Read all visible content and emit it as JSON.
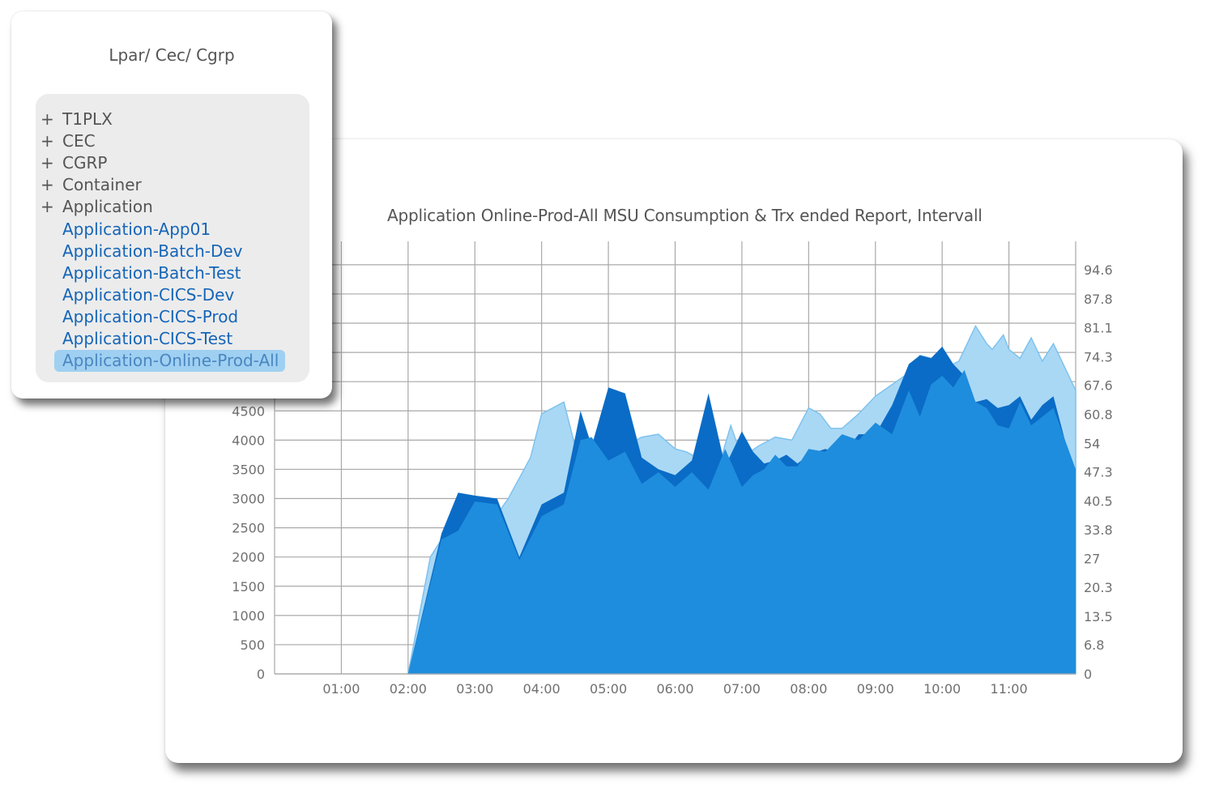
{
  "tree": {
    "header": "Lpar/ Cec/ Cgrp",
    "groups": [
      {
        "expander": "+",
        "label": "T1PLX"
      },
      {
        "expander": "+",
        "label": "CEC"
      },
      {
        "expander": "+",
        "label": "CGRP"
      },
      {
        "expander": "+",
        "label": "Container"
      },
      {
        "expander": "+",
        "label": "Application"
      }
    ],
    "leaves": [
      "Application-App01",
      "Application-Batch-Dev",
      "Application-Batch-Test",
      "Application-CICS-Dev",
      "Application-CICS-Prod",
      "Application-CICS-Test",
      "Application-Online-Prod-All"
    ],
    "selected_index": 6
  },
  "chart_data": {
    "type": "area",
    "title": "Application Online-Prod-All MSU Consumption & Trx ended Report, Intervall",
    "x_ticks": [
      "01:00",
      "02:00",
      "03:00",
      "04:00",
      "05:00",
      "06:00",
      "07:00",
      "08:00",
      "09:00",
      "10:00",
      "11:00"
    ],
    "x_range": [
      "00:00",
      "12:00"
    ],
    "y_left": {
      "ticks": [
        "0",
        "500",
        "1000",
        "1500",
        "2000",
        "2500",
        "3000",
        "3500",
        "4000",
        "4500"
      ],
      "range": [
        0,
        7400
      ]
    },
    "y_right": {
      "ticks": [
        "0",
        "6.8",
        "13.5",
        "20.3",
        "27",
        "33.8",
        "40.5",
        "47.3",
        "54",
        "60.8",
        "67.6",
        "74.3",
        "81.1",
        "87.8",
        "94.6"
      ],
      "range": [
        0,
        100
      ]
    },
    "grid": true,
    "colors": {
      "light_series": "#a9d8f5",
      "light_series_line": "#7ec2ee",
      "dark_series": "#0a6cc6",
      "main_series": "#1e8ddd"
    },
    "series": [
      {
        "style": "light",
        "x": [
          "02:00",
          "02:20",
          "02:30",
          "03:00",
          "03:15",
          "03:30",
          "03:50",
          "04:00",
          "04:10",
          "04:20",
          "04:30",
          "04:50",
          "05:00",
          "05:15",
          "05:30",
          "05:45",
          "06:00",
          "06:10",
          "06:20",
          "06:40",
          "06:50",
          "07:00",
          "07:15",
          "07:30",
          "07:45",
          "08:00",
          "08:10",
          "08:20",
          "08:30",
          "08:45",
          "09:00",
          "09:15",
          "09:30",
          "09:40",
          "09:50",
          "10:00",
          "10:15",
          "10:30",
          "10:40",
          "10:45",
          "10:55",
          "11:00",
          "11:10",
          "11:20",
          "11:30",
          "11:40",
          "11:50",
          "12:00"
        ],
        "y": [
          0,
          2000,
          2300,
          2300,
          2600,
          3000,
          3700,
          4450,
          4550,
          4650,
          3900,
          4000,
          3900,
          3900,
          4050,
          4100,
          3850,
          3800,
          3700,
          3600,
          4250,
          3700,
          3900,
          4050,
          4000,
          4550,
          4450,
          4200,
          4200,
          4450,
          4750,
          4950,
          5150,
          5450,
          5400,
          5200,
          5350,
          5950,
          5650,
          5550,
          5800,
          5550,
          5400,
          5750,
          5350,
          5650,
          5250,
          4850
        ]
      },
      {
        "style": "dark",
        "x": [
          "02:00",
          "02:30",
          "02:45",
          "03:00",
          "03:20",
          "03:40",
          "04:00",
          "04:20",
          "04:35",
          "04:45",
          "05:00",
          "05:15",
          "05:30",
          "05:45",
          "06:00",
          "06:15",
          "06:30",
          "06:45",
          "07:00",
          "07:10",
          "07:20",
          "07:30",
          "07:40",
          "07:50",
          "08:00",
          "08:15",
          "08:30",
          "08:45",
          "09:00",
          "09:15",
          "09:30",
          "09:40",
          "09:50",
          "10:00",
          "10:10",
          "10:20",
          "10:30",
          "10:40",
          "10:50",
          "11:00",
          "11:10",
          "11:20",
          "11:30",
          "11:40",
          "12:00"
        ],
        "y": [
          0,
          2400,
          3100,
          3050,
          3000,
          2000,
          2900,
          3100,
          4500,
          3900,
          4900,
          4800,
          3700,
          3500,
          3400,
          3650,
          4800,
          3550,
          4150,
          3800,
          3600,
          3650,
          3750,
          3600,
          3750,
          3850,
          3750,
          4100,
          4100,
          4600,
          5300,
          5450,
          5400,
          5600,
          5300,
          5100,
          4650,
          4700,
          4550,
          4600,
          4750,
          4350,
          4600,
          4750,
          3300
        ]
      },
      {
        "style": "main",
        "x": [
          "02:00",
          "02:30",
          "02:45",
          "03:00",
          "03:20",
          "03:40",
          "04:00",
          "04:20",
          "04:35",
          "04:45",
          "05:00",
          "05:15",
          "05:30",
          "05:45",
          "06:00",
          "06:15",
          "06:30",
          "06:45",
          "07:00",
          "07:10",
          "07:20",
          "07:30",
          "07:40",
          "07:50",
          "08:00",
          "08:15",
          "08:30",
          "08:45",
          "09:00",
          "09:15",
          "09:30",
          "09:40",
          "09:50",
          "10:00",
          "10:10",
          "10:20",
          "10:30",
          "10:40",
          "10:50",
          "11:00",
          "11:10",
          "11:20",
          "11:30",
          "11:40",
          "12:00"
        ],
        "y": [
          0,
          2300,
          2450,
          2950,
          2900,
          1950,
          2700,
          2900,
          4000,
          4050,
          3650,
          3800,
          3250,
          3450,
          3200,
          3450,
          3150,
          3850,
          3200,
          3400,
          3500,
          3750,
          3550,
          3550,
          3850,
          3800,
          4100,
          4000,
          4300,
          4100,
          4850,
          4400,
          4950,
          5100,
          4900,
          5200,
          4650,
          4550,
          4250,
          4200,
          4650,
          4250,
          4400,
          4550,
          3500
        ]
      }
    ]
  }
}
